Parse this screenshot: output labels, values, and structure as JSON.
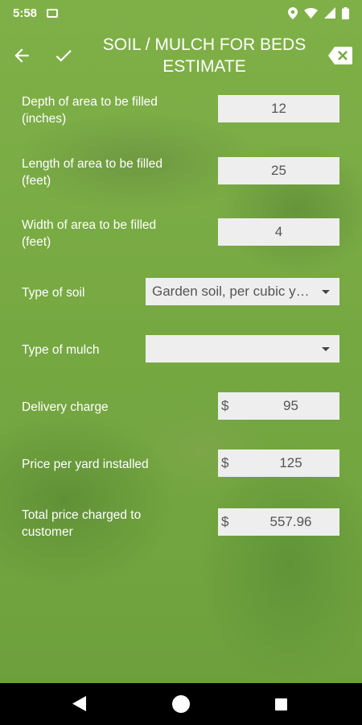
{
  "status": {
    "time": "5:58"
  },
  "toolbar": {
    "title": "SOIL / MULCH FOR BEDS ESTIMATE"
  },
  "fields": [
    {
      "label": "Depth of area to be filled (inches)",
      "value": "12"
    },
    {
      "label": "Length of area to be filled (feet)",
      "value": "25"
    },
    {
      "label": "Width of area to be filled (feet)",
      "value": "4"
    }
  ],
  "soil": {
    "label": "Type of soil",
    "selected": "Garden soil, per cubic yard"
  },
  "mulch": {
    "label": "Type of mulch",
    "selected": ""
  },
  "delivery": {
    "label": "Delivery charge",
    "currency": "$",
    "value": "95"
  },
  "price_per_yard": {
    "label": "Price per yard installed",
    "currency": "$",
    "value": "125"
  },
  "total": {
    "label": "Total price charged to customer",
    "currency": "$",
    "value": "557.96"
  },
  "colors": {
    "field_bg": "#eeeeee",
    "tint": "#82b446"
  }
}
